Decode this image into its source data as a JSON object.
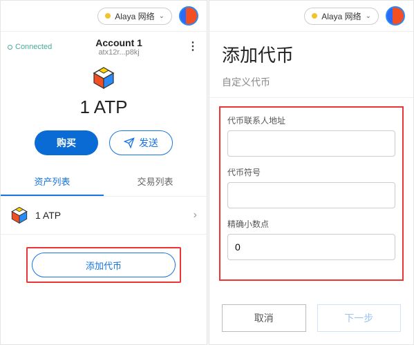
{
  "network": {
    "label": "Alaya 网络"
  },
  "left": {
    "connected_label": "Connected",
    "account_name": "Account 1",
    "account_addr": "atx12r...p8kj",
    "balance": "1 ATP",
    "buy_label": "购买",
    "send_label": "发送",
    "tabs": {
      "assets": "资产列表",
      "txs": "交易列表"
    },
    "assets": [
      {
        "name": "1 ATP"
      }
    ],
    "add_token_label": "添加代币"
  },
  "right": {
    "title": "添加代币",
    "subtab": "自定义代币",
    "fields": {
      "contract_label": "代币联系人地址",
      "contract_value": "",
      "symbol_label": "代币符号",
      "symbol_value": "",
      "decimals_label": "精确小数点",
      "decimals_value": "0"
    },
    "cancel_label": "取消",
    "next_label": "下一步"
  }
}
